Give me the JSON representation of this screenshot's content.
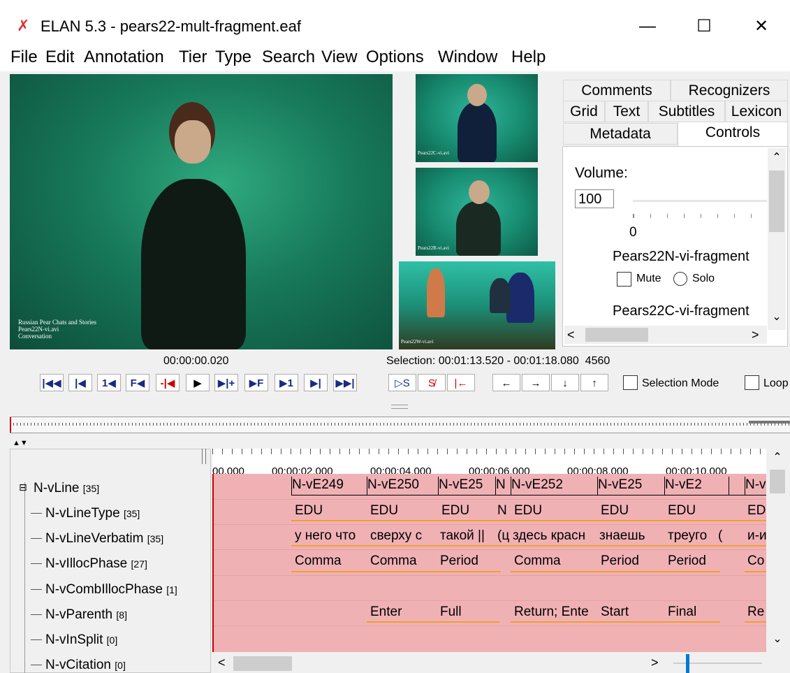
{
  "window": {
    "title": "ELAN 5.3 - pears22-mult-fragment.eaf",
    "app_icon": "elan-x-icon",
    "controls": {
      "minimize": "—",
      "maximize": "☐",
      "close": "✕"
    }
  },
  "menu": [
    "File",
    "Edit",
    "Annotation",
    "Tier",
    "Type",
    "Search",
    "View",
    "Options",
    "Window",
    "Help"
  ],
  "videos": {
    "main_caption": [
      "Russian Pear Chats and Stories",
      "Pears22N-vi.avi",
      "Conversation"
    ],
    "thumb_captions": [
      "Pears22C-vi.avi",
      "Pears22R-vi.avi",
      "Pears22W-vi.avi"
    ]
  },
  "tabs": {
    "row1": [
      "Comments",
      "Recognizers"
    ],
    "row2": [
      "Grid",
      "Text",
      "Subtitles",
      "Lexicon"
    ],
    "row3": [
      "Metadata",
      "Controls"
    ],
    "selected": "Controls"
  },
  "controls_panel": {
    "volume_label": "Volume:",
    "volume_value": "100",
    "slider_zero": "0",
    "track1_name": "Pears22N-vi-fragment",
    "mute_label": "Mute",
    "solo_label": "Solo",
    "track2_name": "Pears22C-vi-fragment"
  },
  "player": {
    "time": "00:00:00.020",
    "selection": "Selection: 00:01:13.520 - 00:01:18.080  4560",
    "selection_mode_label": "Selection Mode",
    "loop_label": "Loop",
    "media_buttons": [
      "|◀◀",
      "|◀",
      "1◀",
      "F◀",
      "-|◀",
      "▶",
      "▶|+",
      "▶F",
      "▶1",
      "▶|",
      "▶▶|"
    ],
    "selection_buttons": [
      "▷S",
      "S̸",
      "|←"
    ],
    "nav_buttons": [
      "←",
      "→",
      "↓",
      "↑"
    ]
  },
  "timeline": {
    "ticks": [
      "00.000",
      "00:00:02.000",
      "00:00:04.000",
      "00:00:06.000",
      "00:00:08.000",
      "00:00:10.000"
    ],
    "tiers": [
      {
        "name": "N-vLine",
        "count": "[35]",
        "indent": 0
      },
      {
        "name": "N-vLineType",
        "count": "[35]",
        "indent": 1
      },
      {
        "name": "N-vLineVerbatim",
        "count": "[35]",
        "indent": 1
      },
      {
        "name": "N-vIllocPhase",
        "count": "[27]",
        "indent": 1
      },
      {
        "name": "N-vCombIllocPhase",
        "count": "[1]",
        "indent": 1
      },
      {
        "name": "N-vParenth",
        "count": "[8]",
        "indent": 1
      },
      {
        "name": "N-vInSplit",
        "count": "[0]",
        "indent": 1
      },
      {
        "name": "N-vCitation",
        "count": "[0]",
        "indent": 1
      }
    ],
    "rows": [
      [
        "N-vE249",
        "N-vE250",
        "N-vE25",
        "N",
        "N-vE252",
        "N-vE25",
        "N-vE2",
        "",
        "N-v"
      ],
      [
        "EDU",
        "EDU",
        "EDU",
        "N",
        "EDU",
        "EDU",
        "EDU",
        "",
        "ED"
      ],
      [
        "у него что",
        "сверху с",
        "такой ||",
        "(ц",
        "здесь красн",
        "знаешь",
        "треуго",
        "(",
        "и-и"
      ],
      [
        "Comma",
        "Comma",
        "Period",
        "",
        "Comma",
        "Period",
        "Period",
        "",
        "Co"
      ],
      [],
      [
        "",
        "Enter",
        "Full",
        "",
        "Return; Ente",
        "Start",
        "Final",
        "",
        "Re"
      ]
    ]
  },
  "colors": {
    "annotation_bg": "#f0b1b5",
    "underline": "#f0a030",
    "crosshair": "#cc0000",
    "accent": "#0078d7"
  }
}
